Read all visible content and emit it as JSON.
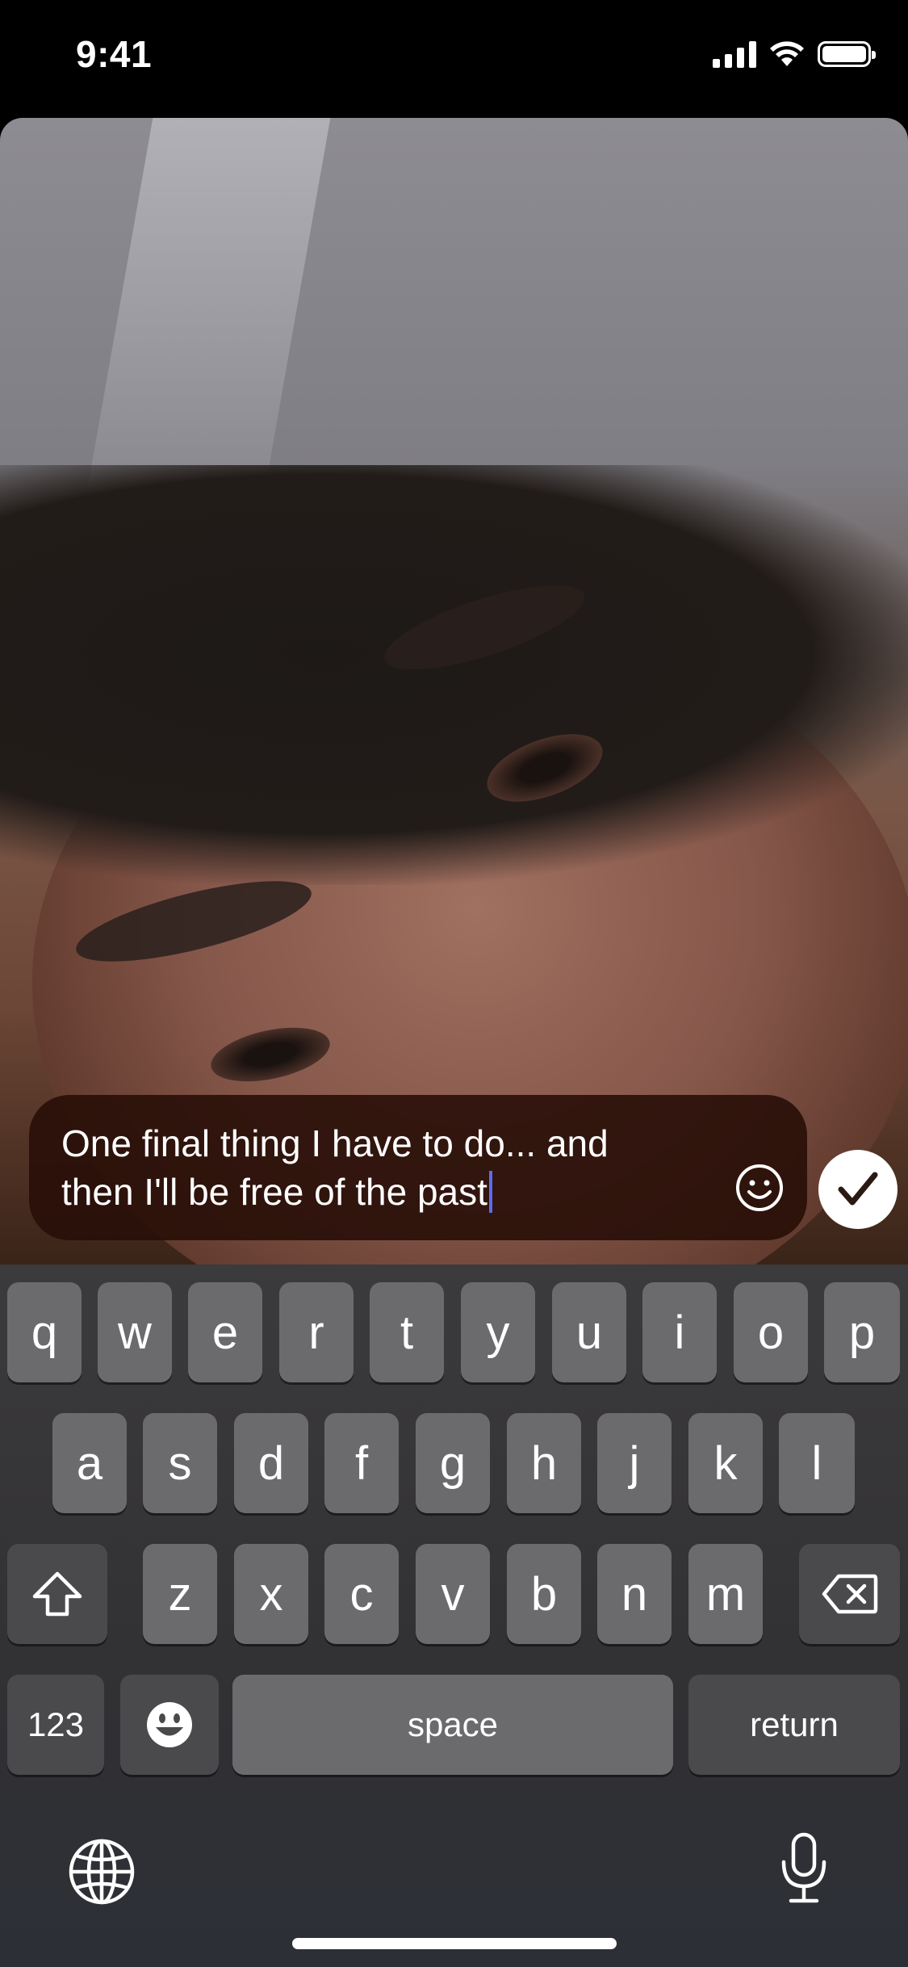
{
  "status_bar": {
    "time": "9:41",
    "icons": [
      "cellular-signal-icon",
      "wifi-icon",
      "battery-icon"
    ]
  },
  "photo": {
    "description_icon": "selfie-photo"
  },
  "caption": {
    "text": "One final thing I have to do... and then I'll be free of the past",
    "line1": "One final thing I have to do... and",
    "line2": "then I'll be free of the past",
    "emoji_icon": "smiley-icon",
    "done_icon": "checkmark-icon"
  },
  "keyboard": {
    "row1": [
      "q",
      "w",
      "e",
      "r",
      "t",
      "y",
      "u",
      "i",
      "o",
      "p"
    ],
    "row2": [
      "a",
      "s",
      "d",
      "f",
      "g",
      "h",
      "j",
      "k",
      "l"
    ],
    "row3": [
      "z",
      "x",
      "c",
      "v",
      "b",
      "n",
      "m"
    ],
    "numbers_label": "123",
    "space_label": "space",
    "return_label": "return",
    "icons": [
      "shift-icon",
      "backspace-icon",
      "emoji-keyboard-icon",
      "globe-icon",
      "microphone-icon"
    ]
  },
  "colors": {
    "caption_bg": "#280e08",
    "caret": "#5b6cf0",
    "key_bg": "#6b6a6d",
    "key_dark_bg": "#4a494c"
  }
}
